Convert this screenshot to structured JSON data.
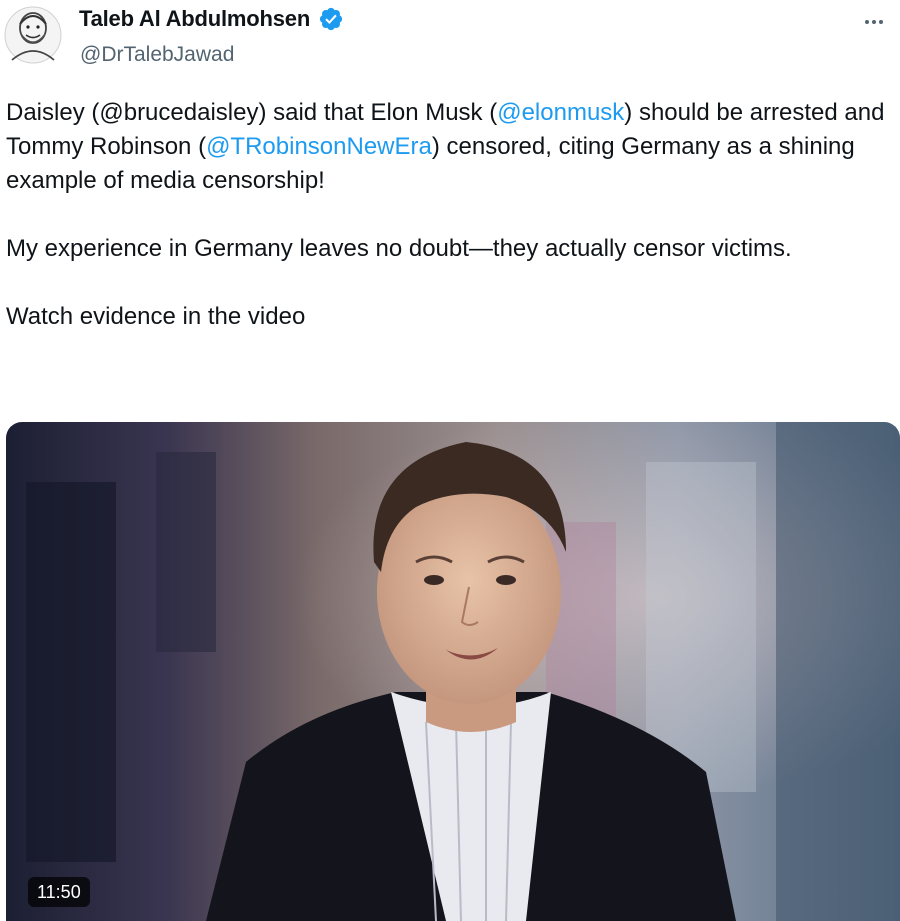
{
  "tweet": {
    "author": {
      "display_name": "Taleb Al Abdulmohsen",
      "handle": "@DrTalebJawad",
      "verified": true
    },
    "text": {
      "p1": {
        "a": "Daisley (@brucedaisley) said that Elon Musk (",
        "m1": "@elonmusk",
        "b": ") should be arrested and Tommy Robinson (",
        "m2": "@TRobinsonNewEra",
        "c": ") censored, citing Germany as a shining example of media censorship!"
      },
      "p2": "My experience in Germany leaves no doubt—they actually censor victims.",
      "p3": "Watch evidence in the video"
    },
    "media": {
      "type": "video",
      "duration": "11:50"
    },
    "colors": {
      "mention": "#1d9bf0",
      "verified_badge": "#1d9bf0",
      "text_primary": "#0f1419",
      "text_secondary": "#536471"
    },
    "icons": {
      "verified": "verified-badge-icon",
      "more": "more-options-icon"
    }
  }
}
